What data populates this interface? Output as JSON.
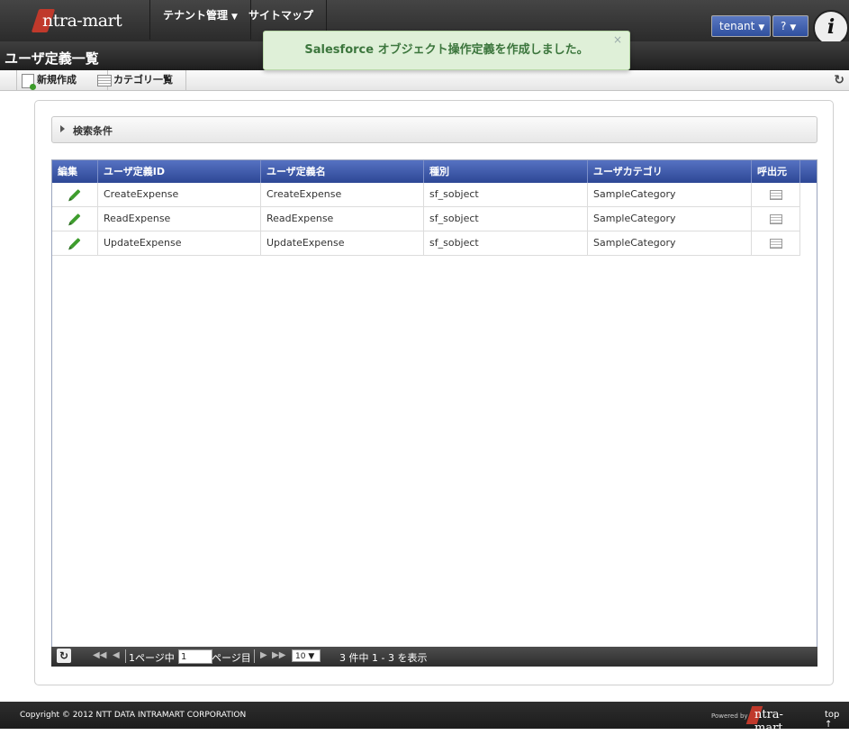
{
  "brand": {
    "logo_text": "ntra-mart"
  },
  "nav": {
    "tenant_menu": "テナント管理",
    "sitemap": "サイトマップ",
    "user_menu": "tenant",
    "help_menu": "?"
  },
  "page": {
    "title": "ユーザ定義一覧"
  },
  "toolbar": {
    "new_label": "新規作成",
    "category_label": "カテゴリ一覧"
  },
  "toast": {
    "message": "Salesforce オブジェクト操作定義を作成しました。",
    "close": "×"
  },
  "search": {
    "label": "検索条件"
  },
  "table": {
    "headers": [
      "編集",
      "ユーザ定義ID",
      "ユーザ定義名",
      "種別",
      "ユーザカテゴリ",
      "呼出元"
    ],
    "rows": [
      {
        "id": "CreateExpense",
        "name": "CreateExpense",
        "type": "sf_sobject",
        "category": "SampleCategory"
      },
      {
        "id": "ReadExpense",
        "name": "ReadExpense",
        "type": "sf_sobject",
        "category": "SampleCategory"
      },
      {
        "id": "UpdateExpense",
        "name": "UpdateExpense",
        "type": "sf_sobject",
        "category": "SampleCategory"
      }
    ]
  },
  "pager": {
    "page_prefix": "1ページ中",
    "page_value": "1",
    "page_suffix": "ページ目",
    "per_page": "10",
    "summary": "3 件中 1 - 3 を表示"
  },
  "footer": {
    "copyright": "Copyright © 2012 NTT DATA INTRAMART CORPORATION",
    "powered_by": "Powered by",
    "logo_text": "ntra-mart",
    "top_link": "top ↑"
  },
  "colors": {
    "header_blue": "#3b56a8",
    "toast_green": "#dff0d8",
    "edit_green": "#3e9d2d"
  }
}
